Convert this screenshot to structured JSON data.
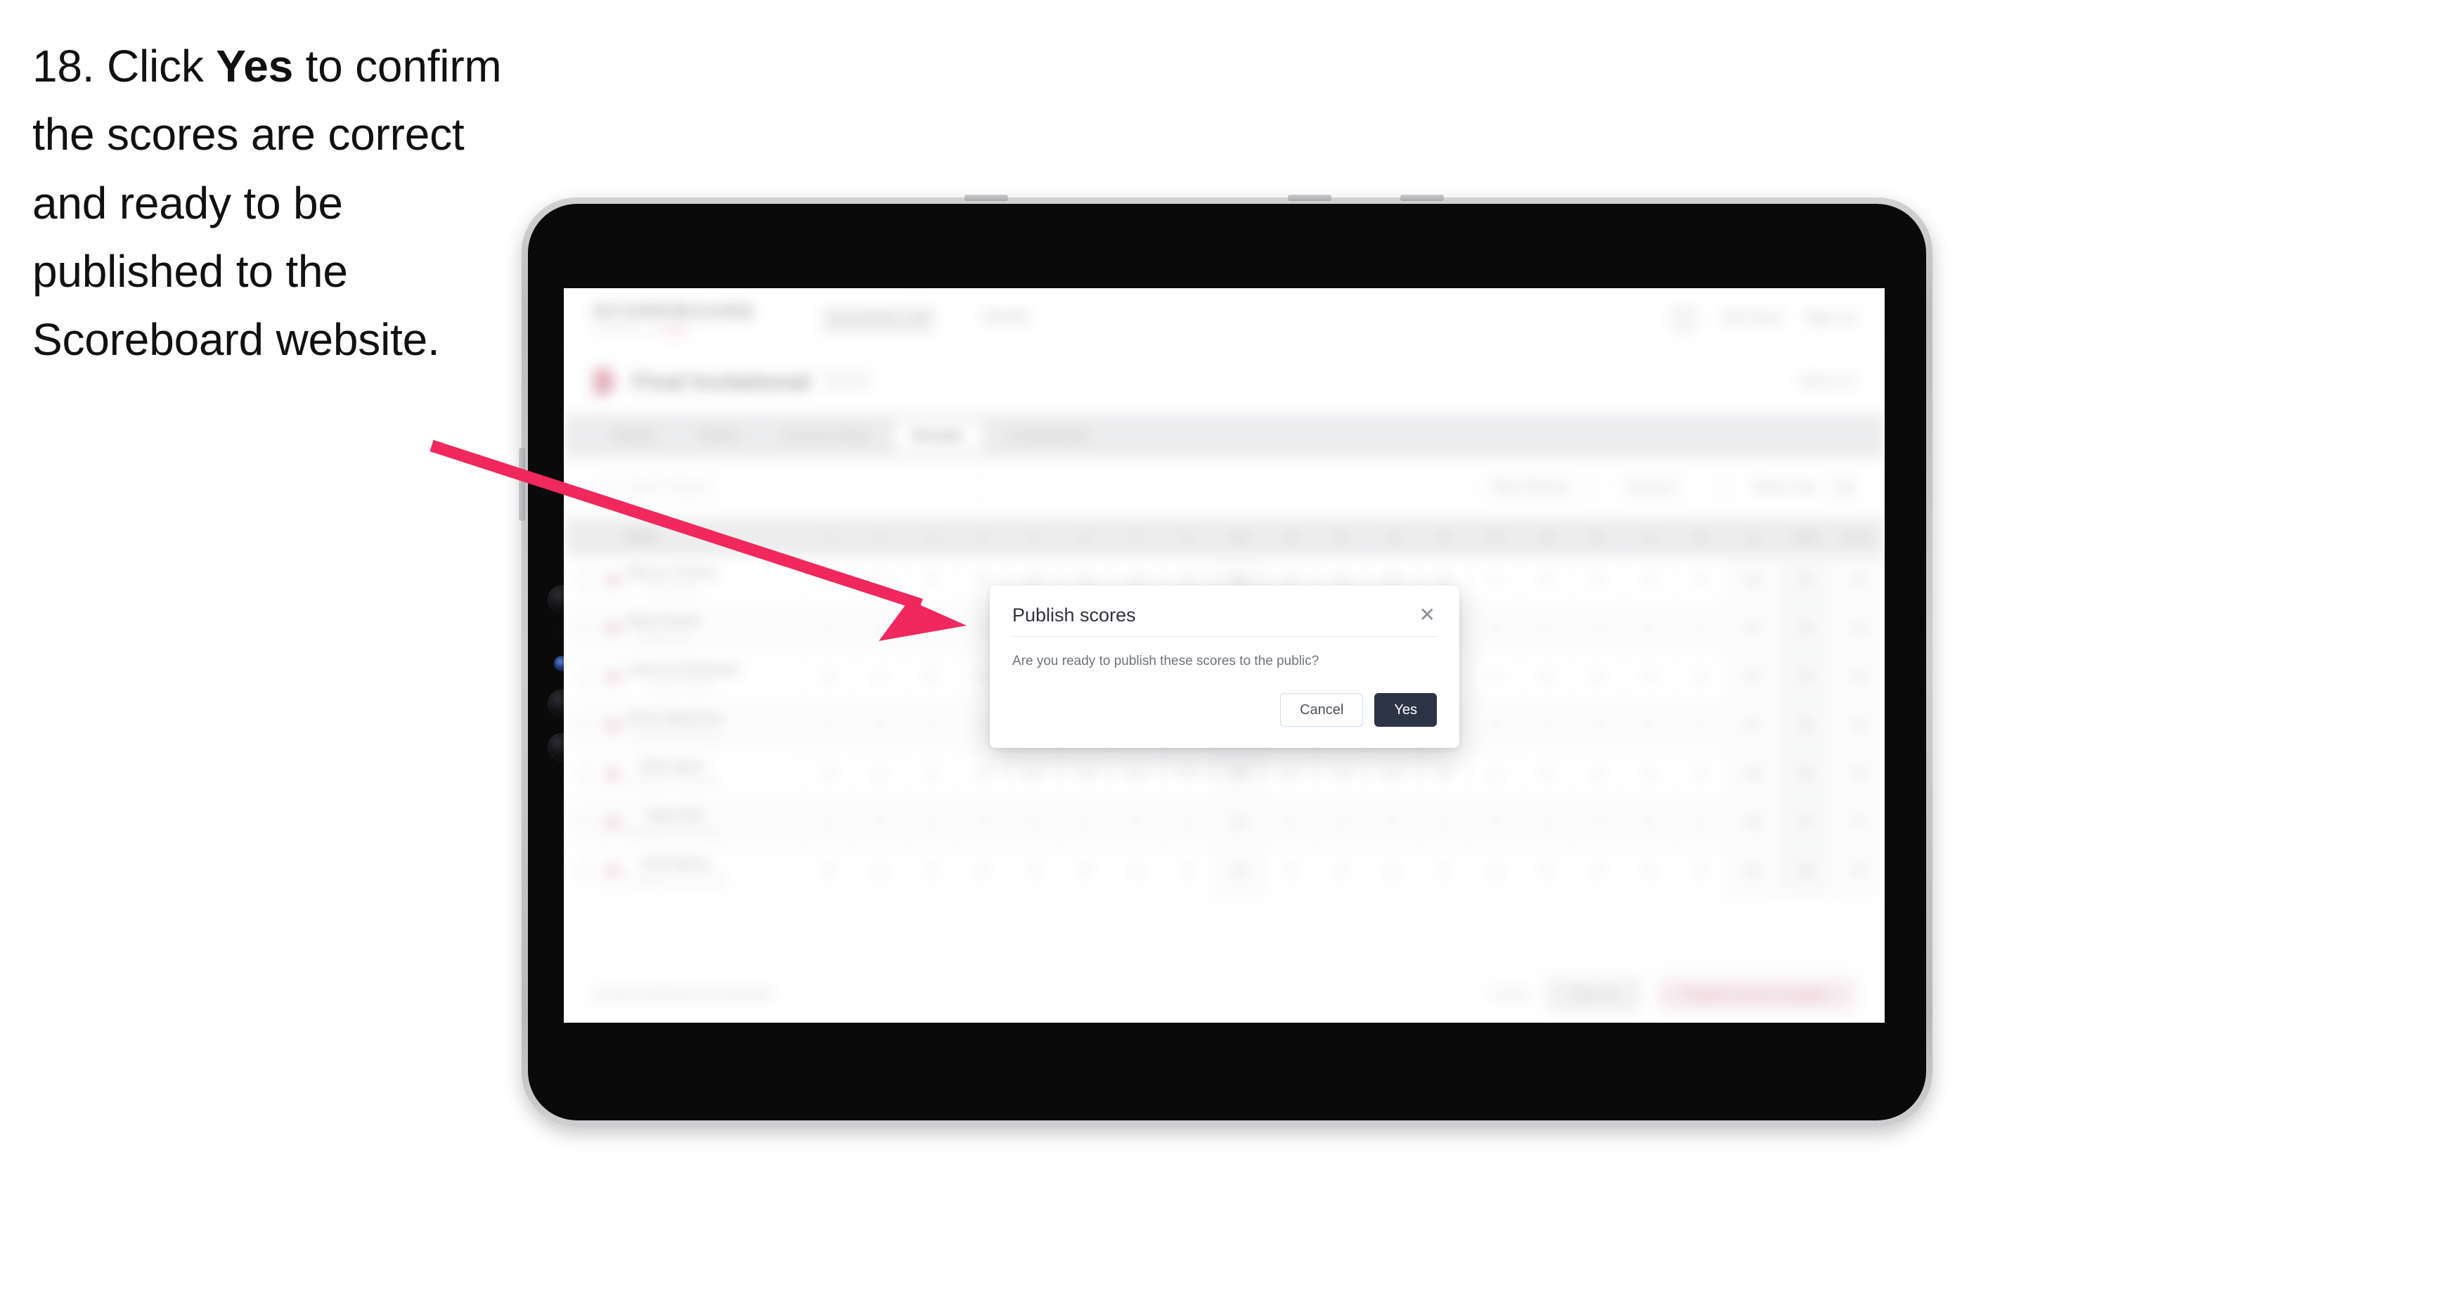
{
  "instruction": {
    "number": "18.",
    "before": "Click",
    "emphasis": "Yes",
    "after": "to confirm the scores are correct and ready to be published to the Scoreboard website."
  },
  "colors": {
    "arrow": "#f0285e",
    "accent_pink": "#f0285e",
    "primary_dark": "#2c3446",
    "cancel_border": "#cfdcf0",
    "tabbar_bg": "#d7d8dc",
    "table_header_bg": "#d8d9dd"
  },
  "app": {
    "header": {
      "brand_name": "SCOREBOARD",
      "brand_sub_text": "POWERED BY",
      "brand_sub_accent": "GOLF",
      "nav": [
        {
          "label": "Tournament Hub",
          "active": true
        },
        {
          "label": "Events",
          "active": false
        }
      ],
      "avatar_icon": "user-avatar-icon",
      "user_name": "Tom Dunn",
      "signout_label": "Sign out"
    },
    "page": {
      "event_flag_icon": "flag-icon",
      "event_title": "Final Invitational",
      "event_year": "2024",
      "event_meta": "Week 12"
    },
    "tabs": [
      {
        "label": "Details",
        "active": false
      },
      {
        "label": "Teams",
        "active": false
      },
      {
        "label": "Course Setup",
        "active": false
      },
      {
        "label": "Results",
        "active": true
      },
      {
        "label": "Leaderboard",
        "active": false
      }
    ],
    "filters": {
      "search_icon": "search-icon",
      "search_placeholder": "Search players",
      "search_value": "",
      "division_select": {
        "label": "Play Division",
        "caret": "chevron-down-icon"
      },
      "round_select": {
        "label": "Round 1",
        "caret": "chevron-down-icon"
      },
      "toggle_label": "Show only",
      "toggle_state": "off"
    },
    "table": {
      "columns": [
        "Player",
        "1",
        "2",
        "3",
        "4",
        "5",
        "6",
        "7",
        "8",
        "Out",
        "10",
        "11",
        "12",
        "13",
        "14",
        "15",
        "16",
        "17",
        "18",
        "In",
        "Total",
        "Score"
      ],
      "header_checkbox_icon": "checkbox-icon",
      "rows": [
        {
          "flag_icon": "flag-icon",
          "name": "Marcus Torrens",
          "club": "Coastal Links",
          "holes": [
            "4",
            "5",
            "4",
            "3",
            "5",
            "4",
            "4",
            "3",
            "36",
            "4",
            "4",
            "5",
            "3",
            "4",
            "4",
            "5",
            "3",
            "4",
            "36",
            "72",
            "+2"
          ]
        },
        {
          "flag_icon": "flag-icon",
          "name": "Rhys Parnell",
          "club": "Coastal Links",
          "holes": [
            "5",
            "4",
            "4",
            "4",
            "4",
            "5",
            "3",
            "4",
            "37",
            "4",
            "5",
            "4",
            "4",
            "3",
            "5",
            "4",
            "4",
            "4",
            "37",
            "74",
            "+4"
          ]
        },
        {
          "flag_icon": "flag-icon",
          "name": "Cameron Bedworth",
          "club": "Harbour Downs",
          "holes": [
            "4",
            "4",
            "5",
            "3",
            "4",
            "4",
            "5",
            "4",
            "37",
            "5",
            "4",
            "4",
            "3",
            "4",
            "4",
            "4",
            "5",
            "4",
            "37",
            "74",
            "+4"
          ]
        },
        {
          "flag_icon": "flag-icon",
          "name": "Oscar Malverney",
          "club": "Greenacres Township",
          "holes": [
            "4",
            "5",
            "4",
            "4",
            "3",
            "5",
            "4",
            "4",
            "37",
            "4",
            "4",
            "5",
            "4",
            "4",
            "3",
            "5",
            "4",
            "4",
            "37",
            "75",
            "+5"
          ]
        },
        {
          "flag_icon": "flag-icon",
          "name": "Elliot Ward",
          "club": "Greenacres Township",
          "holes": [
            "5",
            "4",
            "4",
            "3",
            "5",
            "4",
            "4",
            "5",
            "38",
            "4",
            "5",
            "4",
            "4",
            "4",
            "4",
            "4",
            "4",
            "5",
            "38",
            "76",
            "+6"
          ]
        },
        {
          "flag_icon": "flag-icon",
          "name": "Ryan Kite",
          "club": "Northgate Country Club",
          "holes": [
            "4",
            "4",
            "5",
            "4",
            "4",
            "4",
            "5",
            "4",
            "38",
            "5",
            "4",
            "4",
            "4",
            "5",
            "3",
            "4",
            "5",
            "4",
            "38",
            "77",
            "+7"
          ]
        },
        {
          "flag_icon": "flag-icon",
          "name": "Seth Barley",
          "club": "Northgate Country Club",
          "holes": [
            "5",
            "5",
            "4",
            "4",
            "4",
            "5",
            "4",
            "4",
            "39",
            "4",
            "4",
            "5",
            "4",
            "4",
            "5",
            "4",
            "4",
            "5",
            "39",
            "78",
            "+8"
          ]
        }
      ]
    },
    "actionbar": {
      "status": "Scores published successfully",
      "link_label": "Cancel",
      "secondary_label": "Save all",
      "primary_label": "Publish scores to public"
    }
  },
  "modal": {
    "title": "Publish scores",
    "close_icon": "close-icon",
    "body": "Are you ready to publish these scores to the public?",
    "cancel_label": "Cancel",
    "confirm_label": "Yes"
  }
}
